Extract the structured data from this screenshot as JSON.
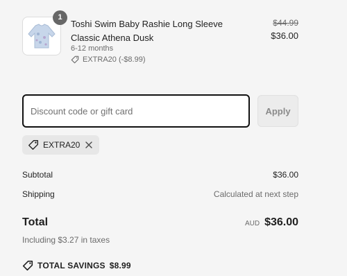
{
  "cart_item": {
    "quantity": "1",
    "title": "Toshi Swim Baby Rashie Long Sleeve Classic Athena Dusk",
    "variant": "6-12 months",
    "discount": "EXTRA20 (-$8.99)",
    "original_price": "$44.99",
    "price": "$36.00"
  },
  "discount_field": {
    "placeholder": "Discount code or gift card",
    "value": "",
    "apply_label": "Apply"
  },
  "applied_code": {
    "code": "EXTRA20"
  },
  "summary": {
    "subtotal_label": "Subtotal",
    "subtotal_value": "$36.00",
    "shipping_label": "Shipping",
    "shipping_value": "Calculated at next step",
    "total_label": "Total",
    "currency": "AUD",
    "total_value": "$36.00",
    "taxes_note": "Including $3.27 in taxes",
    "savings_label": "TOTAL SAVINGS",
    "savings_value": "$8.99"
  },
  "icons": {
    "tag": "tag-icon",
    "remove": "close-icon",
    "product": "product-thumbnail"
  },
  "colors": {
    "badge": "#676767",
    "border_focus": "#111111",
    "muted_text": "#6b6b6b",
    "background": "#f5f5f5"
  }
}
